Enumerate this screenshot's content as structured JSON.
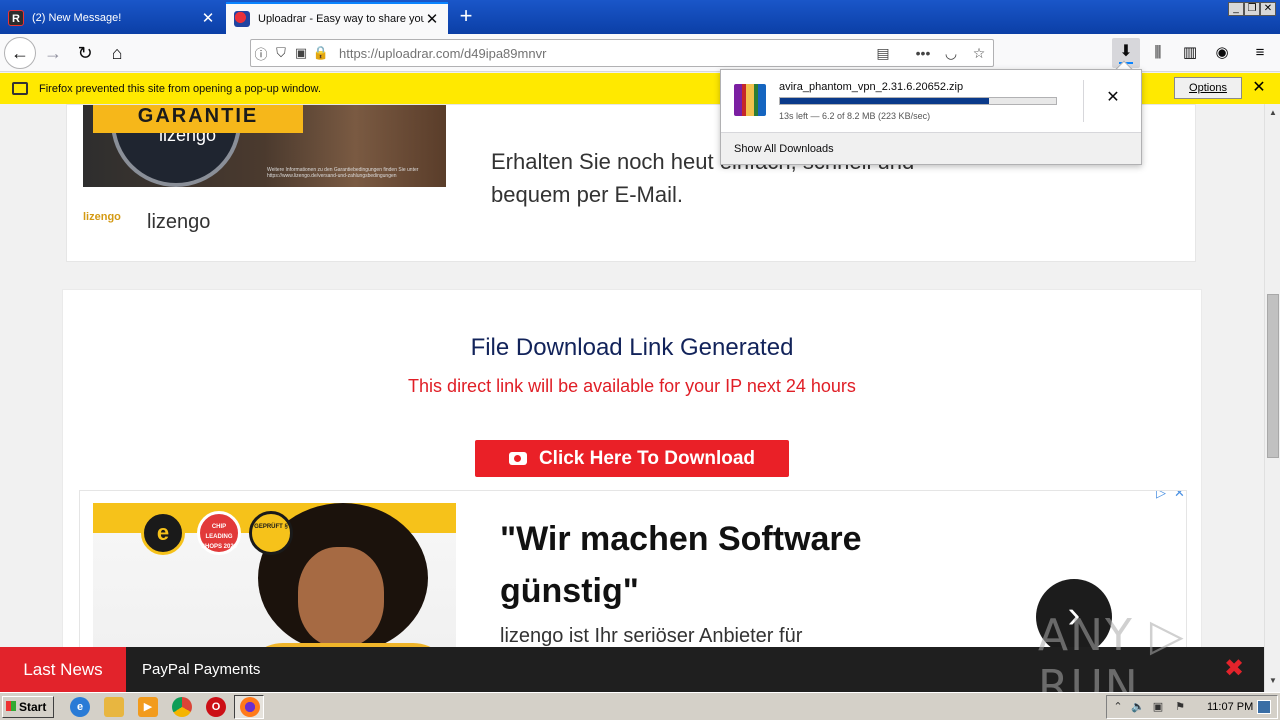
{
  "browser": {
    "tabs": [
      {
        "title": "(2) New Message!",
        "favicon": "r-icon",
        "active": false
      },
      {
        "title": "Uploadrar - Easy way to share you",
        "favicon": "uploadrar-icon",
        "active": true
      }
    ],
    "url": "https://uploadrar.com/d49ipa89mnvr",
    "popup_message": "Firefox prevented this site from opening a pop-up window.",
    "popup_options_label": "Options"
  },
  "download_panel": {
    "filename": "avira_phantom_vpn_2.31.6.20652.zip",
    "status": "13s left — 6.2 of 8.2 MB (223 KB/sec)",
    "progress": 0.756,
    "show_all_label": "Show All Downloads"
  },
  "ad_top": {
    "badge": "GARANTIE",
    "brand_seal": "lizengo",
    "fineprint": "Weitere Informationen zu den Garantiebedingungen finden Sie unter https://www.lizengo.de/versand-und-zahlungsbedingungen",
    "headline": "Erhalten Sie noch heut einfach, schnell und bequem per E-Mail.",
    "logo_text": "lizengo",
    "brand_name": "lizengo"
  },
  "download": {
    "title": "File Download Link Generated",
    "subtitle": "This direct link will be available for your IP next 24 hours",
    "button_label": "Click Here To Download"
  },
  "ad_bottom": {
    "badge_e": "e",
    "badge_chip": "CHIP LEADING SHOPS 2020",
    "badge_geprueft": "GEPRÜFT §",
    "headline": "\"Wir machen Software günstig\"",
    "body": "lizengo ist Ihr seriöser Anbieter für",
    "adchoice": "▷",
    "adclose": "✕"
  },
  "ticker": {
    "label": "Last News",
    "item": "PayPal Payments"
  },
  "watermark": "ANY ▷ RUN",
  "taskbar": {
    "start_label": "Start",
    "clock": "11:07 PM"
  },
  "colors": {
    "accent_red": "#ea2027",
    "title_navy": "#12235a",
    "notification_yellow": "#ffe900",
    "progress_blue": "#0a3a8a"
  }
}
